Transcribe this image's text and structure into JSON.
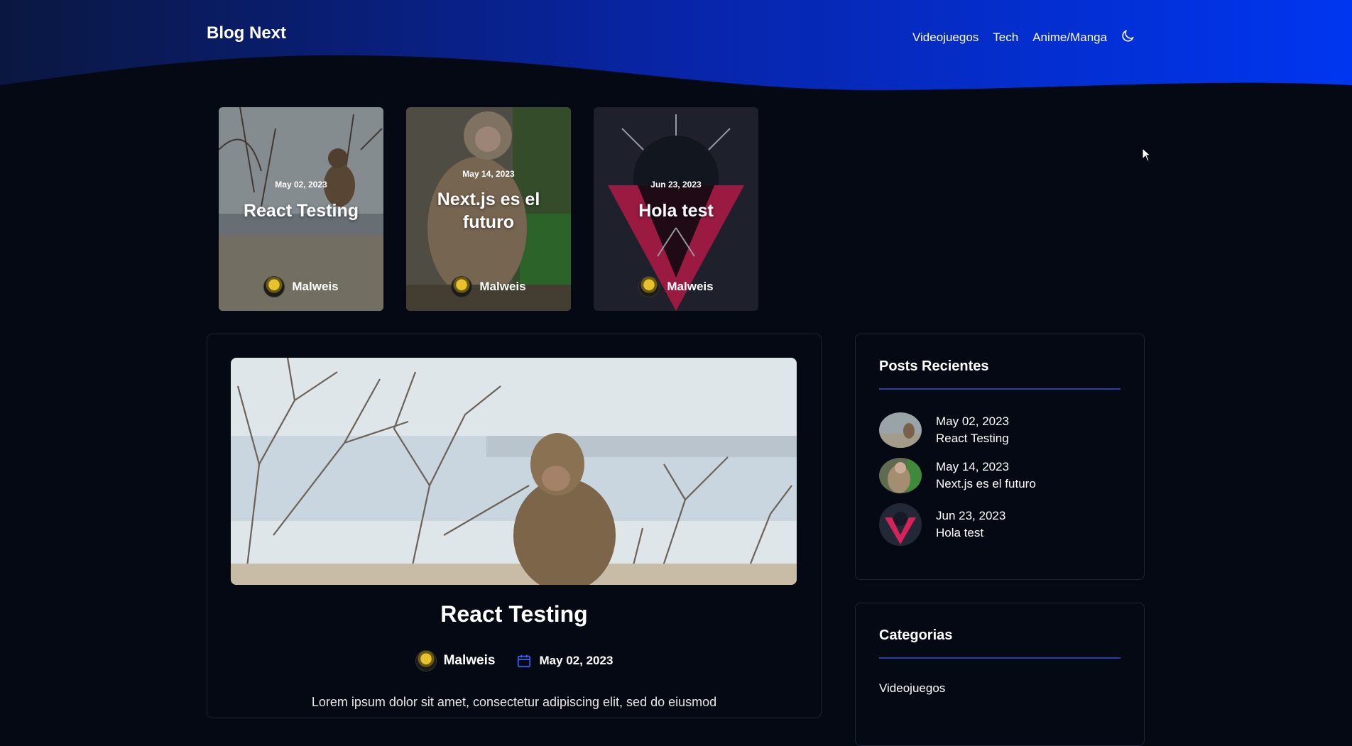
{
  "header": {
    "brand": "Blog Next",
    "nav": [
      "Videojuegos",
      "Tech",
      "Anime/Manga"
    ],
    "theme_toggle_icon": "moon-icon"
  },
  "featured": [
    {
      "date": "May 02, 2023",
      "title": "React Testing",
      "author": "Malweis"
    },
    {
      "date": "May 14, 2023",
      "title": "Next.js es el futuro",
      "author": "Malweis"
    },
    {
      "date": "Jun 23, 2023",
      "title": "Hola test",
      "author": "Malweis"
    }
  ],
  "post": {
    "title": "React Testing",
    "author": "Malweis",
    "date": "May 02, 2023",
    "excerpt": "Lorem ipsum dolor sit amet, consectetur adipiscing elit, sed do eiusmod"
  },
  "sidebar": {
    "recent_title": "Posts Recientes",
    "recent": [
      {
        "date": "May 02, 2023",
        "title": "React Testing"
      },
      {
        "date": "May 14, 2023",
        "title": "Next.js es el futuro"
      },
      {
        "date": "Jun 23, 2023",
        "title": "Hola test"
      }
    ],
    "categories_title": "Categorias",
    "categories": [
      "Videojuegos"
    ]
  },
  "colors": {
    "background": "#050914",
    "header_gradient_start": "#0a1a4a",
    "header_gradient_end": "#0033e6",
    "accent_rule": "#2b3ea8",
    "calendar_icon": "#3d63ff"
  }
}
